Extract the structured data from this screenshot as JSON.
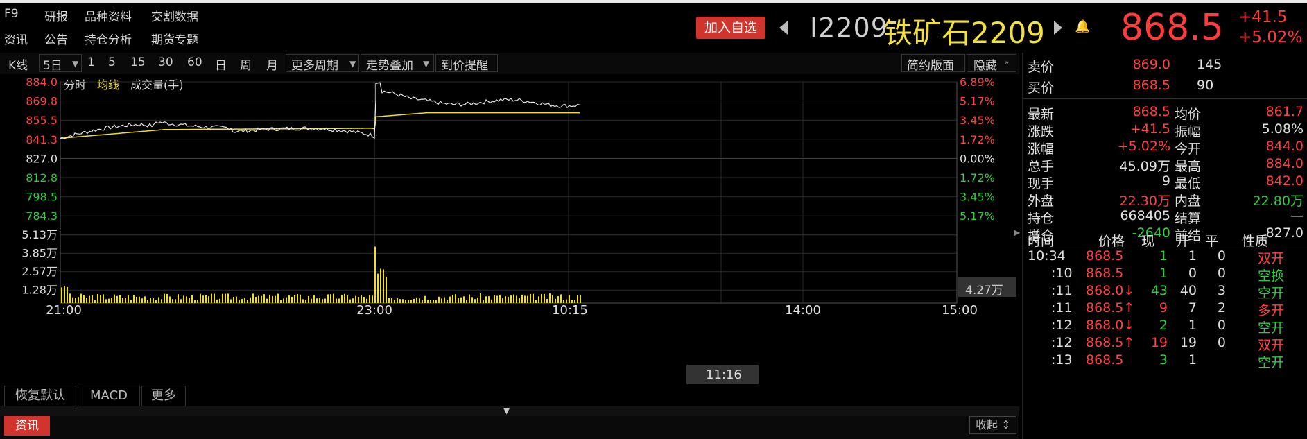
{
  "menu": {
    "row1": [
      "F9",
      "研报",
      "品种资料",
      "交割数据"
    ],
    "row2": [
      "资讯",
      "公告",
      "持仓分析",
      "期货专题"
    ]
  },
  "header": {
    "add_watch": "加入自选",
    "code": "I2209",
    "name": "铁矿石2209",
    "price": "868.5",
    "change": "+41.5",
    "change_pct": "+5.02%",
    "colors": {
      "up": "#ff3b3b",
      "down": "#2ecc40",
      "name": "#f2e040"
    }
  },
  "toolbar": {
    "kline": "K线",
    "period": "5日",
    "minutes": [
      "1",
      "5",
      "15",
      "30",
      "60"
    ],
    "day": "日",
    "week": "周",
    "month": "月",
    "more_period": "更多周期",
    "overlay": "走势叠加",
    "price_alert": "到价提醒",
    "simple_layout": "简约版面",
    "hide": "隐藏"
  },
  "chart_legend": {
    "fenshi": "分时",
    "avg": "均线",
    "volume": "成交量(手)"
  },
  "chart_data": {
    "type": "line",
    "price_axis_left": [
      "884.0",
      "869.8",
      "855.5",
      "841.3",
      "827.0",
      "812.8",
      "798.5",
      "784.3"
    ],
    "price_axis_right": [
      "6.89%",
      "5.17%",
      "3.45%",
      "1.72%",
      "0.00%",
      "1.72%",
      "3.45%",
      "5.17%"
    ],
    "volume_axis": [
      "5.13万",
      "3.85万",
      "2.57万",
      "1.28万"
    ],
    "volume_marker": "4.27万",
    "x_labels": [
      "21:00",
      "23:00",
      "10:15",
      "14:00",
      "15:00"
    ],
    "x_cursor": "11:16",
    "ylim": [
      784.3,
      884.0
    ],
    "series": [
      {
        "name": "分时",
        "color": "#e8e8e8"
      },
      {
        "name": "均线",
        "color": "#f0e020"
      }
    ]
  },
  "bottom_tabs": [
    "恢复默认",
    "MACD",
    "更多"
  ],
  "news_tab": "资讯",
  "collapse": "收起",
  "quote": {
    "sell": {
      "label": "卖价",
      "price": "869.0",
      "vol": "145"
    },
    "buy": {
      "label": "买价",
      "price": "868.5",
      "vol": "90"
    },
    "rows": [
      {
        "l1": "最新",
        "v1": "868.5",
        "l2": "均价",
        "v2": "861.7"
      },
      {
        "l1": "涨跌",
        "v1": "+41.5",
        "l2": "振幅",
        "v2": "5.08%"
      },
      {
        "l1": "涨幅",
        "v1": "+5.02%",
        "l2": "今开",
        "v2": "844.0"
      },
      {
        "l1": "总手",
        "v1": "45.09万",
        "l2": "最高",
        "v2": "884.0"
      },
      {
        "l1": "现手",
        "v1": "9",
        "l2": "最低",
        "v2": "842.0"
      },
      {
        "l1": "外盘",
        "v1": "22.30万",
        "l2": "内盘",
        "v2": "22.80万"
      },
      {
        "l1": "持仓",
        "v1": "668405",
        "l2": "结算",
        "v2": "—"
      },
      {
        "l1": "增仓",
        "v1": "-2640",
        "l2": "前结",
        "v2": "827.0"
      }
    ]
  },
  "ticks": {
    "headers": [
      "时间",
      "价格",
      "现",
      "开",
      "平",
      "性质"
    ],
    "rows": [
      {
        "time": "10:34",
        "price": "868.5",
        "arrow": "",
        "now": "1",
        "open": "1",
        "close": "0",
        "type": "双开"
      },
      {
        "time": ":10",
        "price": "868.5",
        "arrow": "",
        "now": "1",
        "open": "0",
        "close": "0",
        "type": "空换"
      },
      {
        "time": ":11",
        "price": "868.0",
        "arrow": "↓",
        "now": "43",
        "open": "40",
        "close": "3",
        "type": "空开"
      },
      {
        "time": ":11",
        "price": "868.5",
        "arrow": "↑",
        "now": "9",
        "open": "7",
        "close": "2",
        "type": "多开"
      },
      {
        "time": ":12",
        "price": "868.0",
        "arrow": "↓",
        "now": "2",
        "open": "1",
        "close": "0",
        "type": "空开"
      },
      {
        "time": ":12",
        "price": "868.5",
        "arrow": "↑",
        "now": "19",
        "open": "19",
        "close": "0",
        "type": "双开"
      },
      {
        "time": ":13",
        "price": "868.5",
        "arrow": "",
        "now": "3",
        "open": "1",
        "close": "",
        "type": "空开"
      }
    ]
  }
}
